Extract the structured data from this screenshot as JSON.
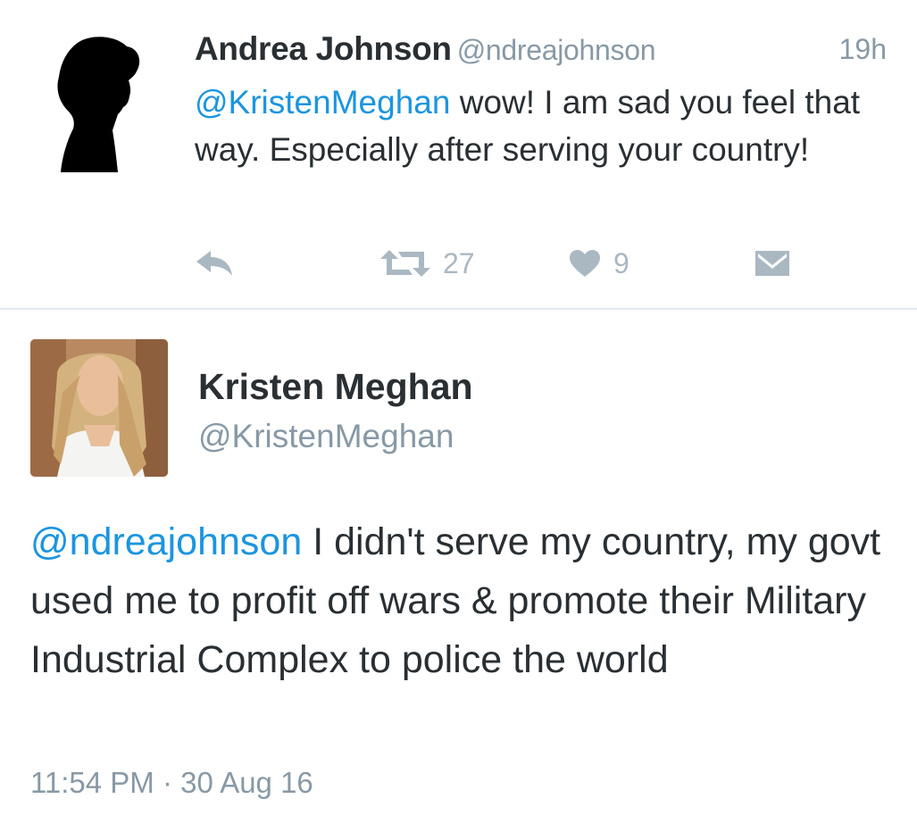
{
  "reply_tweet": {
    "author_name": "Andrea Johnson",
    "author_handle": "@ndreajohnson",
    "time_ago": "19h",
    "text_mention": "@KristenMeghan",
    "text_body": " wow! I am sad you feel that way. Especially after serving your country!",
    "actions": {
      "reply_icon": "reply-icon",
      "retweet_icon": "retweet-icon",
      "retweet_count": "27",
      "like_icon": "heart-icon",
      "like_count": "9",
      "dm_icon": "envelope-icon"
    }
  },
  "main_tweet": {
    "author_name": "Kristen Meghan",
    "author_handle": "@KristenMeghan",
    "text_mention": "@ndreajohnson",
    "text_body": " I didn't serve my country, my govt used me to profit off wars & promote their Military Industrial Complex to police the world",
    "time": "11:54 PM",
    "separator": " · ",
    "date": "30 Aug 16"
  },
  "colors": {
    "link": "#1b95e0",
    "muted": "#8899a6",
    "icon": "#aab8c2",
    "text": "#292f33"
  }
}
